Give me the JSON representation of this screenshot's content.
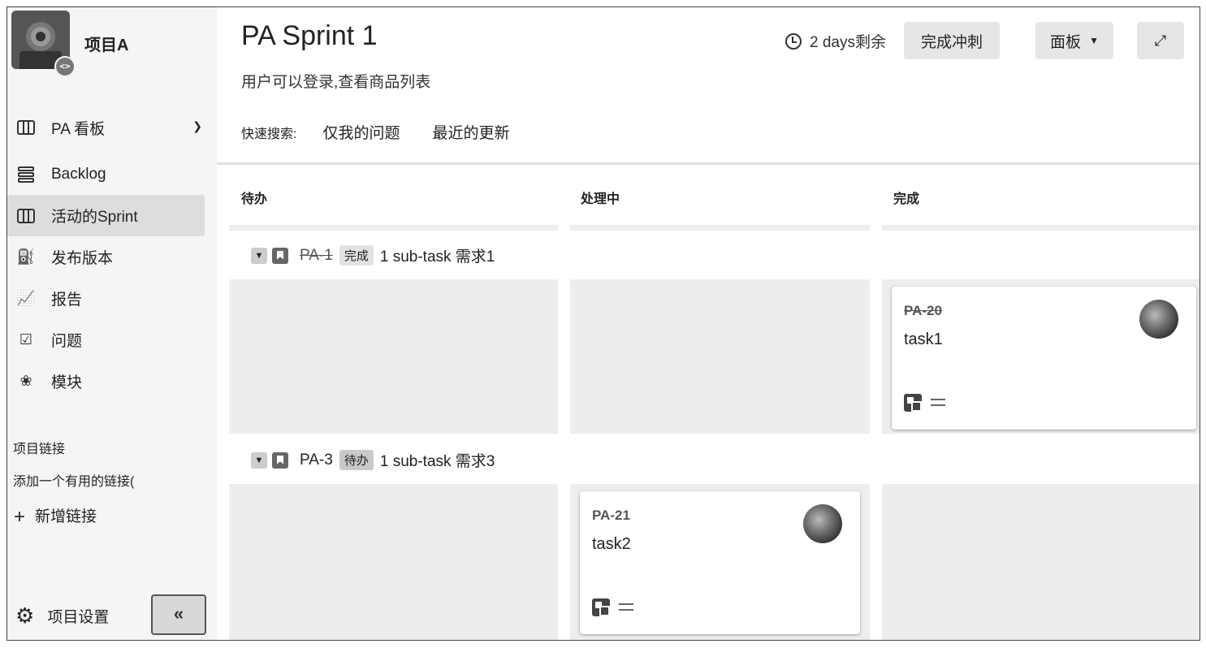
{
  "project": {
    "name": "项目A",
    "badge": "<>"
  },
  "nav": {
    "board": {
      "label": "PA 看板"
    },
    "items": [
      {
        "label": "Backlog",
        "icon": "backlog-icon"
      },
      {
        "label": "活动的Sprint",
        "icon": "board-columns-icon",
        "active": true
      },
      {
        "label": "发布版本",
        "icon": "ship-icon"
      },
      {
        "label": "报告",
        "icon": "chart-icon"
      },
      {
        "label": "问题",
        "icon": "issues-icon"
      },
      {
        "label": "模块",
        "icon": "puzzle-icon"
      }
    ]
  },
  "links": {
    "title": "项目链接",
    "description": "添加一个有用的链接(",
    "add_label": "新增链接"
  },
  "settings": {
    "label": "项目设置",
    "collapse": "«"
  },
  "sprint": {
    "title": "PA Sprint 1",
    "goal": "用户可以登录,查看商品列表",
    "remaining": "2 days剩余",
    "complete_button": "完成冲刺",
    "board_button": "面板",
    "expand_icon": "expand-icon"
  },
  "quick_filters": {
    "label": "快速搜索:",
    "filters": [
      "仅我的问题",
      "最近的更新"
    ]
  },
  "columns": [
    "待办",
    "处理中",
    "完成"
  ],
  "swimlanes": [
    {
      "key": "PA-1",
      "status": "完成",
      "summary": "1 sub-task 需求1",
      "done": true
    },
    {
      "key": "PA-3",
      "status": "待办",
      "summary": "1 sub-task 需求3",
      "done": false
    }
  ],
  "cards": [
    {
      "key": "PA-20",
      "summary": "task1",
      "done": true,
      "lane": 0,
      "column": 2
    },
    {
      "key": "PA-21",
      "summary": "task2",
      "done": false,
      "lane": 1,
      "column": 1
    }
  ]
}
